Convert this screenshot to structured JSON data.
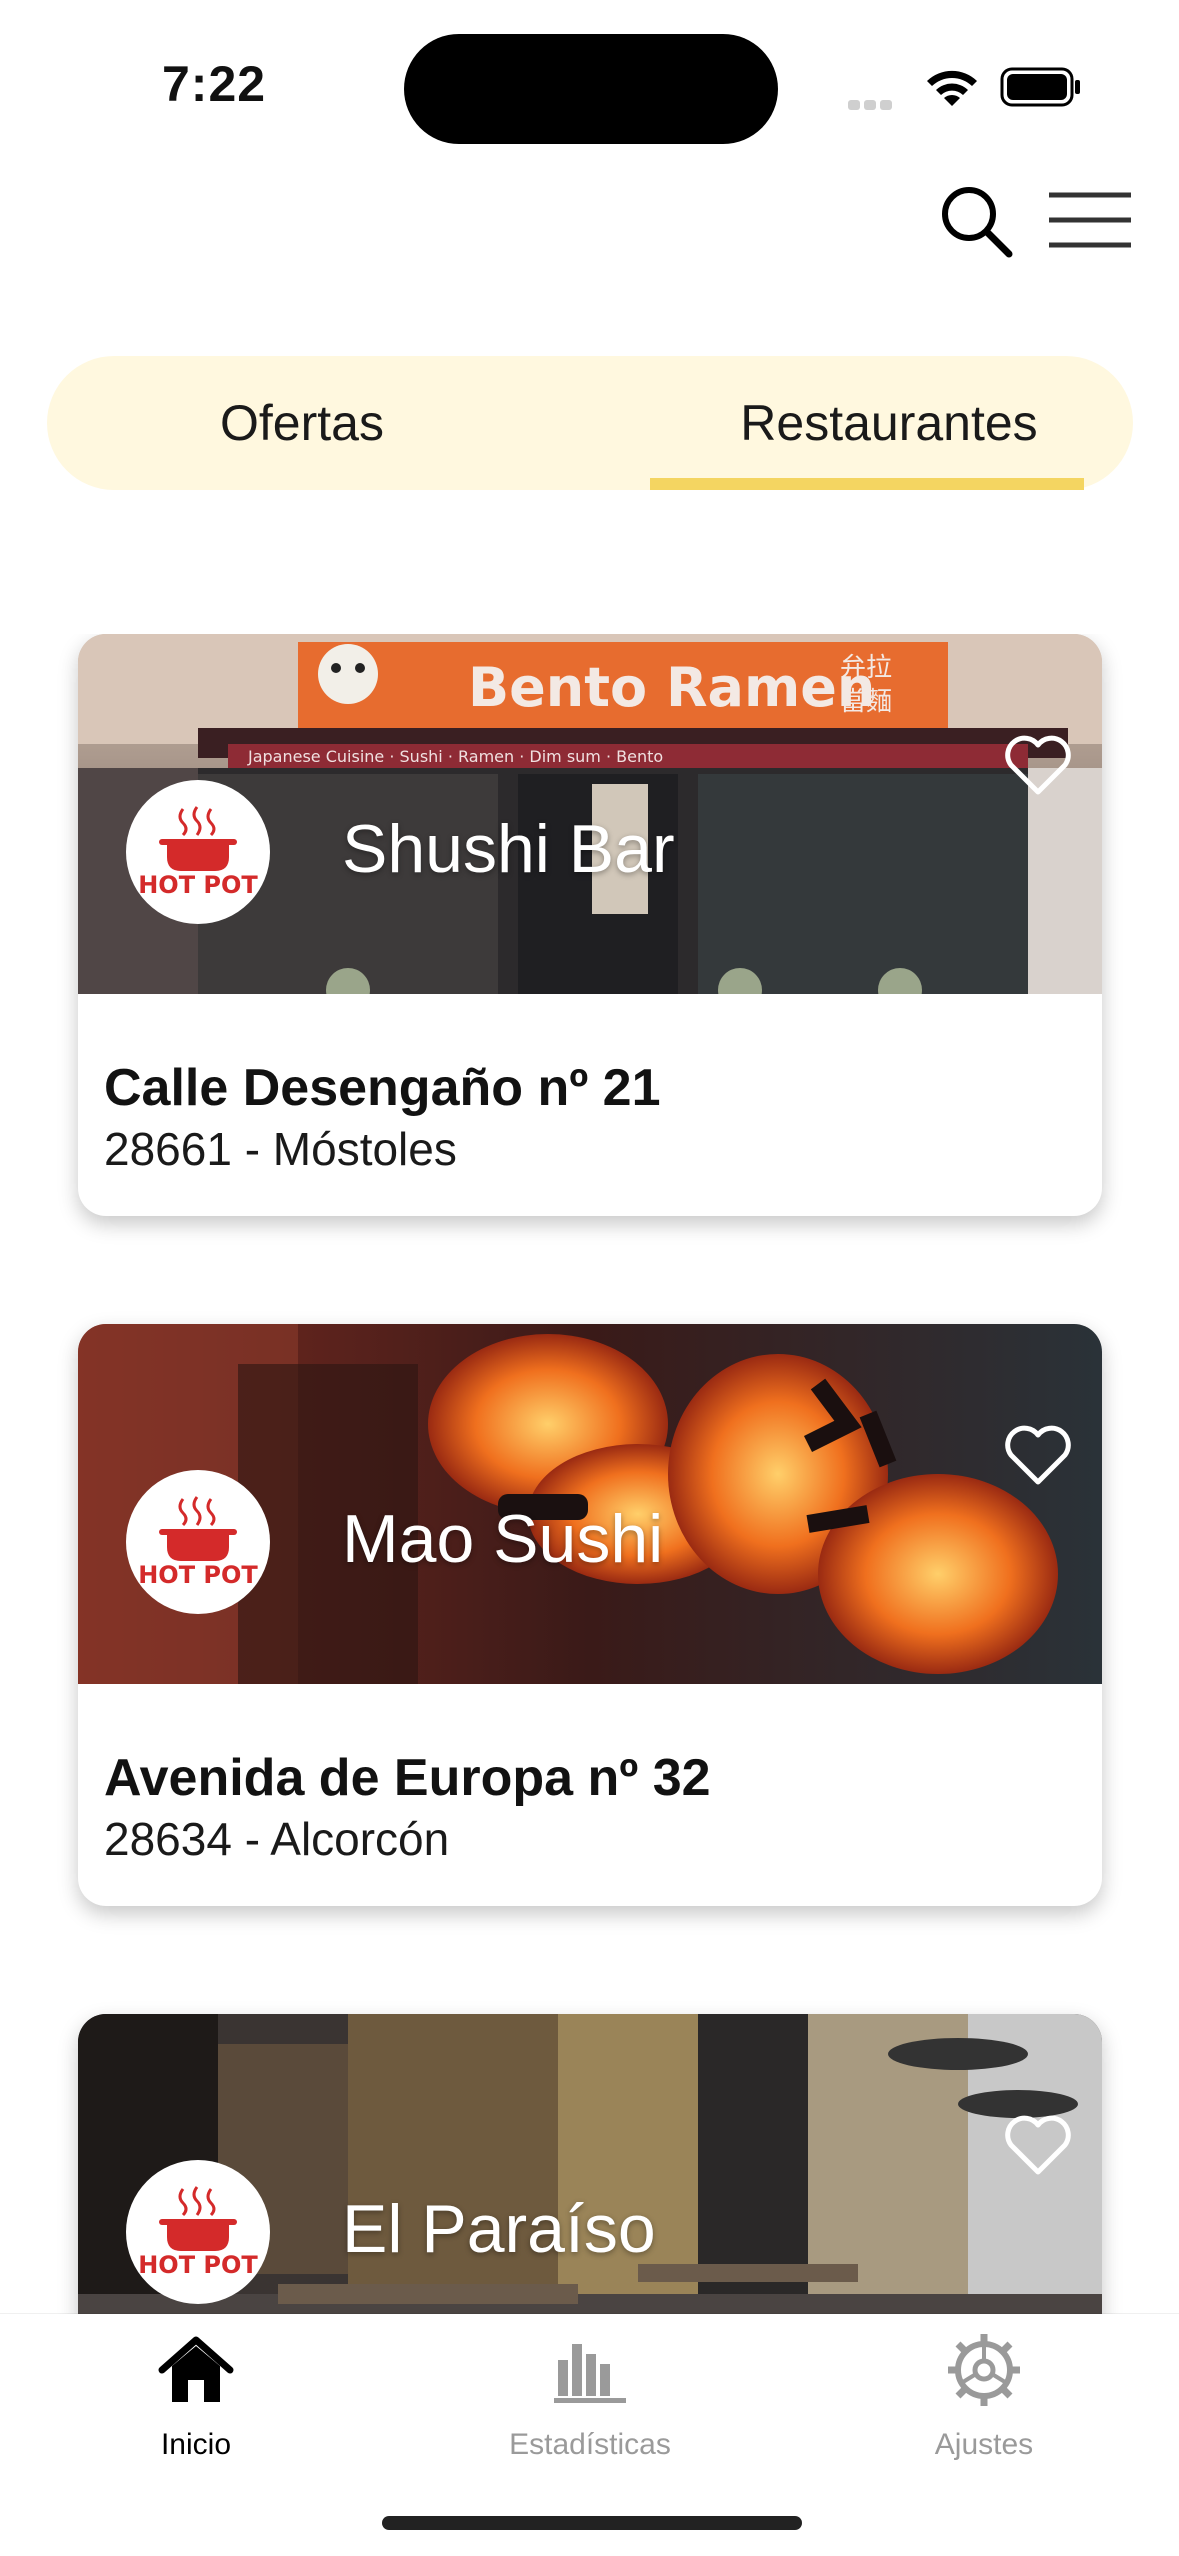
{
  "status_bar": {
    "time": "7:22"
  },
  "header": {
    "search_icon": "search-icon",
    "menu_icon": "hamburger-menu-icon"
  },
  "tabs": [
    {
      "label": "Ofertas",
      "active": false
    },
    {
      "label": "Restaurantes",
      "active": true
    }
  ],
  "accent_color": "#f4d561",
  "tabs_background": "#fff8df",
  "logo_text": "HOT POT",
  "restaurants": [
    {
      "name": "Shushi Bar",
      "street": "Calle Desengaño nº 21",
      "city_line": "28661 - Móstoles",
      "sign": {
        "title": "Bento Ramen",
        "cjk": "弁拉",
        "cjk2": "當麵",
        "strip": "Japanese Cuisine  ·  Sushi  ·  Ramen  ·  Dim sum  ·  Bento"
      }
    },
    {
      "name": "Mao Sushi",
      "street": "Avenida de Europa nº 32",
      "city_line": "28634 - Alcorcón"
    },
    {
      "name": "El Paraíso",
      "street": "",
      "city_line": ""
    }
  ],
  "tabbar": [
    {
      "label": "Inicio",
      "icon": "home-icon",
      "active": true
    },
    {
      "label": "Estadísticas",
      "icon": "bar-chart-icon",
      "active": false
    },
    {
      "label": "Ajustes",
      "icon": "gear-icon",
      "active": false
    }
  ]
}
